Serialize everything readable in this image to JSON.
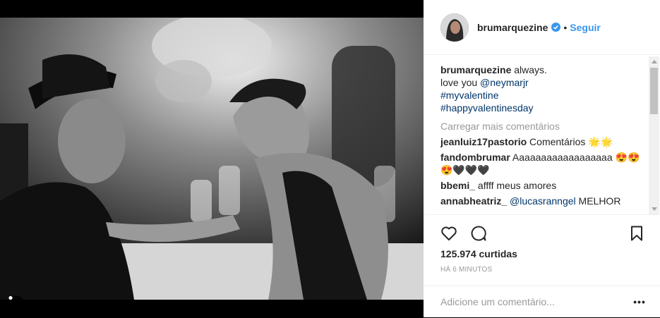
{
  "post": {
    "author": "brumarquezine",
    "separator": "•",
    "follow_label": "Seguir",
    "caption": {
      "text": "always.",
      "line2_prefix": "love you ",
      "mention": "@neymarjr",
      "hashtag1": "#myvalentine",
      "hashtag2": "#happyvalentinesday"
    },
    "load_more": "Carregar mais comentários",
    "comments": [
      {
        "user": "jeanluiz17pastorio",
        "text": "Comentários 🌟🌟"
      },
      {
        "user": "fandombrumar",
        "text": "Aaaaaaaaaaaaaaaaaa 😍😍😍🖤🖤🖤"
      },
      {
        "user": "bbemi_",
        "text": "affff meus amores"
      },
      {
        "user": "annabheatriz_",
        "mention": "@lucasranngel",
        "text": " MELHOR"
      }
    ],
    "likes": "125.974 curtidas",
    "time": "HÁ 6 MINUTOS",
    "add_comment_placeholder": "Adicione um comentário...",
    "more_label": "•••",
    "carousel": {
      "count": 2,
      "active_index": 0
    }
  },
  "icons": {
    "verified": "verified-badge-icon",
    "like": "heart-icon",
    "comment": "comment-icon",
    "save": "bookmark-icon",
    "tag": "user-tag-icon"
  },
  "colors": {
    "link_blue": "#3897f0",
    "mention": "#003569",
    "muted": "#999999",
    "text": "#262626",
    "divider": "#efefef"
  }
}
